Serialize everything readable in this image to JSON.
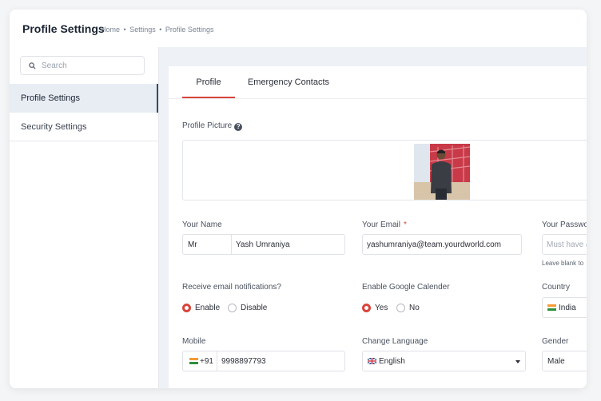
{
  "header": {
    "title": "Profile Settings",
    "breadcrumb": [
      "Home",
      "•",
      "Settings",
      "•",
      "Profile Settings"
    ]
  },
  "sidebar": {
    "search_placeholder": "Search",
    "items": [
      {
        "label": "Profile Settings",
        "active": true
      },
      {
        "label": "Security Settings",
        "active": false
      }
    ]
  },
  "tabs": [
    {
      "label": "Profile",
      "active": true
    },
    {
      "label": "Emergency Contacts",
      "active": false
    }
  ],
  "profile_picture": {
    "label": "Profile Picture",
    "help": "?"
  },
  "form": {
    "name": {
      "label": "Your Name",
      "title_value": "Mr",
      "value": "Yash Umraniya"
    },
    "email": {
      "label": "Your Email",
      "required_mark": "*",
      "value": "yashumraniya@team.yourdworld.com"
    },
    "password": {
      "label": "Your Passwo",
      "placeholder": "Must have a",
      "hint": "Leave blank to"
    },
    "email_notifications": {
      "label": "Receive email notifications?",
      "options": [
        "Enable",
        "Disable"
      ],
      "selected": "Enable"
    },
    "google_calendar": {
      "label": "Enable Google Calender",
      "options": [
        "Yes",
        "No"
      ],
      "selected": "Yes"
    },
    "country": {
      "label": "Country",
      "value": "India"
    },
    "mobile": {
      "label": "Mobile",
      "code": "+91",
      "value": "9998897793"
    },
    "language": {
      "label": "Change Language",
      "value": "English"
    },
    "gender": {
      "label": "Gender",
      "value": "Male"
    }
  },
  "colors": {
    "accent": "#d9453b",
    "active_sidebar": "#e8edf4",
    "main_bg": "#eef1f5"
  },
  "icons": {
    "search": "search-icon",
    "help": "help-icon",
    "flag_india": "india-flag-icon",
    "flag_uk": "uk-flag-icon",
    "dropdown": "chevron-down-icon"
  }
}
